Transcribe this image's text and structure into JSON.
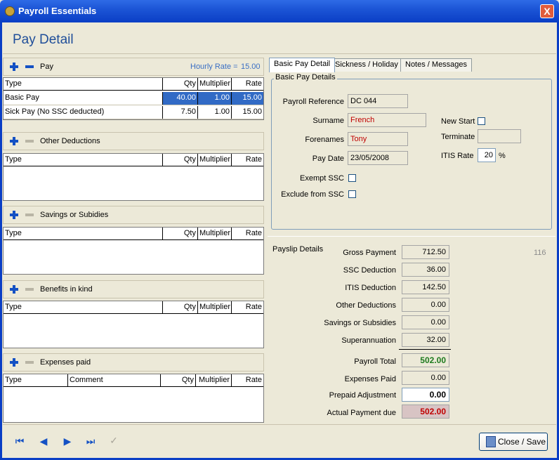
{
  "window": {
    "title": "Payroll Essentials",
    "close_glyph": "X"
  },
  "page_title": "Pay Detail",
  "pay_section": {
    "label": "Pay",
    "hourly_rate_label": "Hourly Rate =",
    "hourly_rate_value": "15.00",
    "columns": [
      "Type",
      "Qty",
      "Multiplier",
      "Rate"
    ],
    "rows": [
      {
        "type": "Basic Pay",
        "qty": "40.00",
        "multiplier": "1.00",
        "rate": "15.00"
      },
      {
        "type": "Sick Pay (No SSC deducted)",
        "qty": "7.50",
        "multiplier": "1.00",
        "rate": "15.00"
      }
    ]
  },
  "other_deductions": {
    "label": "Other Deductions",
    "columns": [
      "Type",
      "Qty",
      "Multiplier",
      "Rate"
    ]
  },
  "savings": {
    "label": "Savings or Subidies",
    "columns": [
      "Type",
      "Qty",
      "Multiplier",
      "Rate"
    ]
  },
  "benefits": {
    "label": "Benefits in kind",
    "columns": [
      "Type",
      "Qty",
      "Multiplier",
      "Rate"
    ]
  },
  "expenses": {
    "label": "Expenses paid",
    "columns": [
      "Type",
      "Comment",
      "Qty",
      "Multiplier",
      "Rate"
    ]
  },
  "tabs": [
    "Basic Pay Detail",
    "Sickness / Holiday",
    "Notes / Messages"
  ],
  "basic_pay": {
    "group_label": "Basic Pay Details",
    "payroll_reference_label": "Payroll  Reference",
    "payroll_reference": "DC 044",
    "surname_label": "Surname",
    "surname": "French",
    "forenames_label": "Forenames",
    "forenames": "Tony",
    "pay_date_label": "Pay Date",
    "pay_date": "23/05/2008",
    "exempt_ssc_label": "Exempt SSC",
    "exclude_ssc_label": "Exclude from SSC",
    "new_start_label": "New Start",
    "terminate_label": "Terminate",
    "terminate_value": "",
    "itis_rate_label": "ITIS Rate",
    "itis_rate": "20",
    "itis_unit": "%"
  },
  "payslip": {
    "label": "Payslip Details",
    "counter": "116",
    "gross_label": "Gross Payment",
    "gross": "712.50",
    "ssc_label": "SSC Deduction",
    "ssc": "36.00",
    "itis_label": "ITIS Deduction",
    "itis": "142.50",
    "other_label": "Other Deductions",
    "other": "0.00",
    "savings_label": "Savings or Subsidies",
    "savings": "0.00",
    "super_label": "Superannuation",
    "super": "32.00",
    "total_label": "Payroll Total",
    "total": "502.00",
    "expenses_label": "Expenses Paid",
    "expenses": "0.00",
    "prepaid_label": "Prepaid Adjustment",
    "prepaid": "0.00",
    "actual_label": "Actual Payment due",
    "actual": "502.00"
  },
  "footer": {
    "close_save_label": "Close / Save",
    "check_glyph": "✓"
  },
  "colors": {
    "titlebar": "#0A3EC5",
    "accent": "#1451C4",
    "selection": "#316AC5",
    "total_green": "#1E7B1E",
    "actual_red": "#C00000",
    "actual_bg": "#D8C4C4"
  }
}
